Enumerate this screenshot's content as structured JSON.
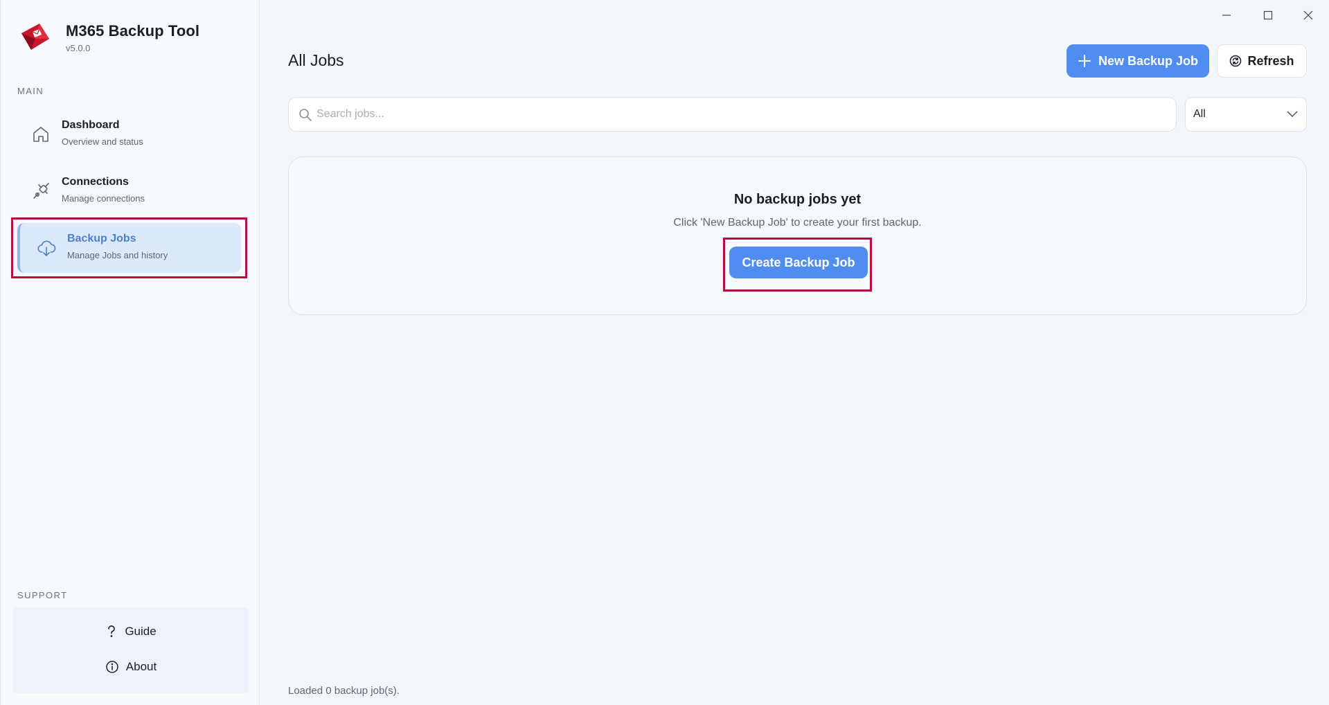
{
  "app": {
    "title": "M365 Backup Tool",
    "version": "v5.0.0"
  },
  "sidebar": {
    "main_label": "MAIN",
    "items": [
      {
        "title": "Dashboard",
        "subtitle": "Overview and status",
        "icon": "home-icon"
      },
      {
        "title": "Connections",
        "subtitle": "Manage connections",
        "icon": "plug-icon"
      },
      {
        "title": "Backup Jobs",
        "subtitle": "Manage Jobs and history",
        "icon": "cloud-download-icon",
        "active": true
      }
    ],
    "support_label": "SUPPORT",
    "support_items": [
      {
        "label": "Guide",
        "icon": "question-icon"
      },
      {
        "label": "About",
        "icon": "info-icon"
      }
    ]
  },
  "header": {
    "title": "All Jobs",
    "new_button": "New Backup Job",
    "refresh_button": "Refresh"
  },
  "filters": {
    "search_placeholder": "Search jobs...",
    "search_value": "",
    "status_selected": "All"
  },
  "empty_state": {
    "title": "No backup jobs yet",
    "subtitle": "Click 'New Backup Job' to create your first backup.",
    "button": "Create Backup Job"
  },
  "status": {
    "text": "Loaded 0 backup job(s)."
  },
  "colors": {
    "accent": "#4f8ef0",
    "highlight": "#b3103b",
    "active_bg": "#dce9fb",
    "active_text": "#4d7fd0",
    "brand_red": "#c9152b"
  }
}
